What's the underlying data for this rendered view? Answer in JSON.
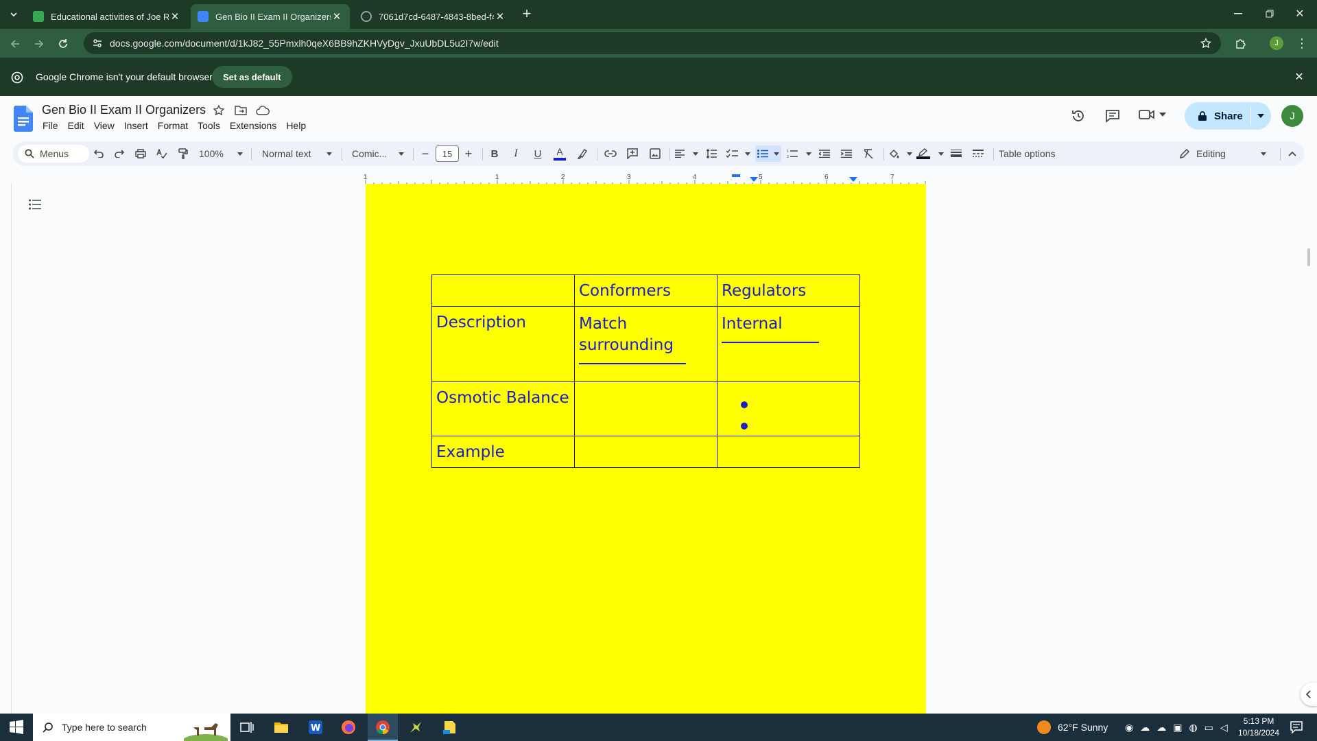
{
  "browser": {
    "tabs": [
      {
        "title": "Educational activities of Joe Rid",
        "favicon_color": "#34a853",
        "active": false
      },
      {
        "title": "Gen Bio II Exam II Organizers - (",
        "favicon_color": "#4285f4",
        "active": true
      },
      {
        "title": "7061d7cd-6487-4843-8bed-f4c",
        "favicon_color": "#9aa0a6",
        "active": false
      }
    ],
    "url": "docs.google.com/document/d/1kJ82_55Pmxlh0qeX6BB9hZKHVyDgv_JxuUbDL5u2I7w/edit",
    "profile_initial": "J",
    "infobar": {
      "message": "Google Chrome isn't your default browser",
      "button": "Set as default"
    }
  },
  "docs": {
    "title": "Gen Bio II Exam II Organizers",
    "menu": [
      "File",
      "Edit",
      "View",
      "Insert",
      "Format",
      "Tools",
      "Extensions",
      "Help"
    ],
    "share_label": "Share",
    "account_initial": "J",
    "toolbar": {
      "search_menus": "Menus",
      "zoom": "100%",
      "style": "Normal text",
      "font": "Comic...",
      "font_size": "15",
      "table_options": "Table options",
      "mode": "Editing"
    },
    "ruler_labels": [
      "1",
      "1",
      "2",
      "3",
      "4",
      "5",
      "6",
      "7"
    ],
    "table": {
      "header": [
        "",
        "Conformers",
        "Regulators"
      ],
      "rows": [
        [
          "Description",
          "Match surrounding",
          "Internal"
        ],
        [
          "Osmotic Balance",
          "",
          ""
        ],
        [
          "Example",
          "",
          ""
        ]
      ]
    },
    "accent_color": "#1c20c8",
    "page_color": "#ffff00"
  },
  "taskbar": {
    "search_placeholder": "Type here to search",
    "weather": "62°F  Sunny",
    "time": "5:13 PM",
    "date": "10/18/2024"
  }
}
